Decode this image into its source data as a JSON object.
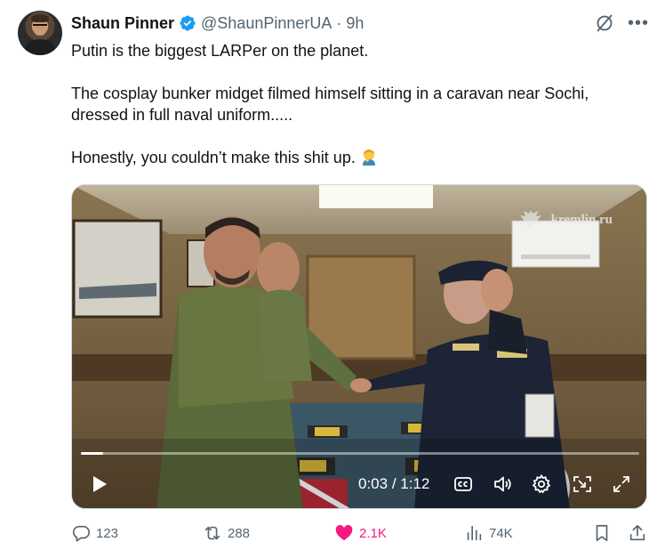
{
  "author": {
    "name": "Shaun Pinner",
    "handle": "@ShaunPinnerUA",
    "separator": "·",
    "time": "9h"
  },
  "tweet": {
    "paragraphs": [
      "Putin is the biggest LARPer on the planet.",
      "The cosplay bunker midget filmed himself sitting in a caravan near Sochi, dressed in full naval uniform.....",
      "Honestly, you couldn’t make this shit up."
    ]
  },
  "video": {
    "watermark": "kremlin.ru",
    "current_time": "0:03",
    "time_separator": "/",
    "duration": "1:12",
    "progress_fraction": 0.04
  },
  "metrics": {
    "replies": "123",
    "reposts": "288",
    "likes": "2.1K",
    "views": "74K"
  },
  "colors": {
    "text": "#0f1419",
    "secondary": "#536471",
    "verified": "#1d9bf0",
    "like": "#f91880"
  },
  "icons": [
    "verified-badge-icon",
    "grok-icon",
    "more-icon",
    "play-icon",
    "captions-icon",
    "volume-icon",
    "settings-icon",
    "pip-icon",
    "fullscreen-icon",
    "reply-icon",
    "repost-icon",
    "like-icon",
    "views-icon",
    "bookmark-icon",
    "share-icon"
  ]
}
